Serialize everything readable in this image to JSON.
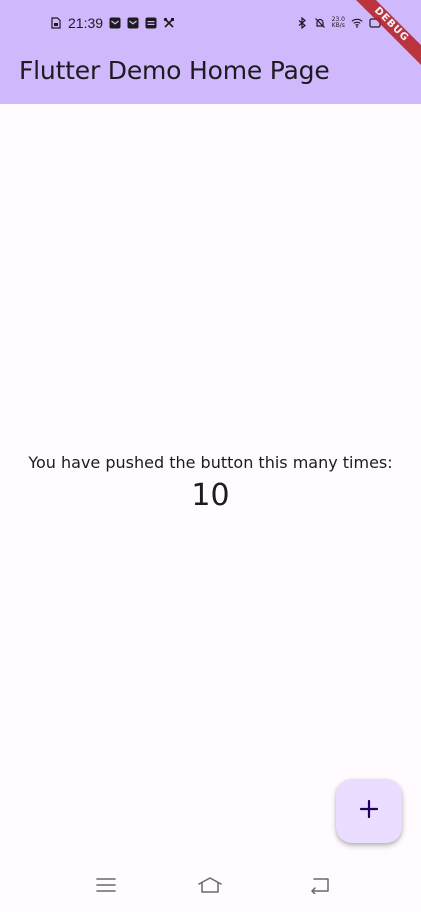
{
  "status_bar": {
    "time": "21:39",
    "left_icons": [
      "sim-icon",
      "mail-icon",
      "mail-icon",
      "message-icon",
      "tools-icon"
    ],
    "right_icons": [
      "bluetooth-icon",
      "mute-icon",
      "wifi-icon",
      "battery-icon"
    ],
    "network_speed_value": "23.0",
    "network_speed_unit": "KB/s"
  },
  "app_bar": {
    "title": "Flutter Demo Home Page",
    "background": "#cfb8fb"
  },
  "debug_banner": {
    "label": "DEBUG",
    "color": "#b71c1c"
  },
  "body": {
    "counter_label": "You have pushed the button this many times:",
    "counter_value": "10",
    "background": "#fffbff"
  },
  "fab": {
    "icon": "plus-icon",
    "background": "#eaddff",
    "icon_color": "#21005d"
  },
  "nav_bar": {
    "buttons": [
      "menu-icon",
      "home-icon",
      "back-icon"
    ]
  }
}
